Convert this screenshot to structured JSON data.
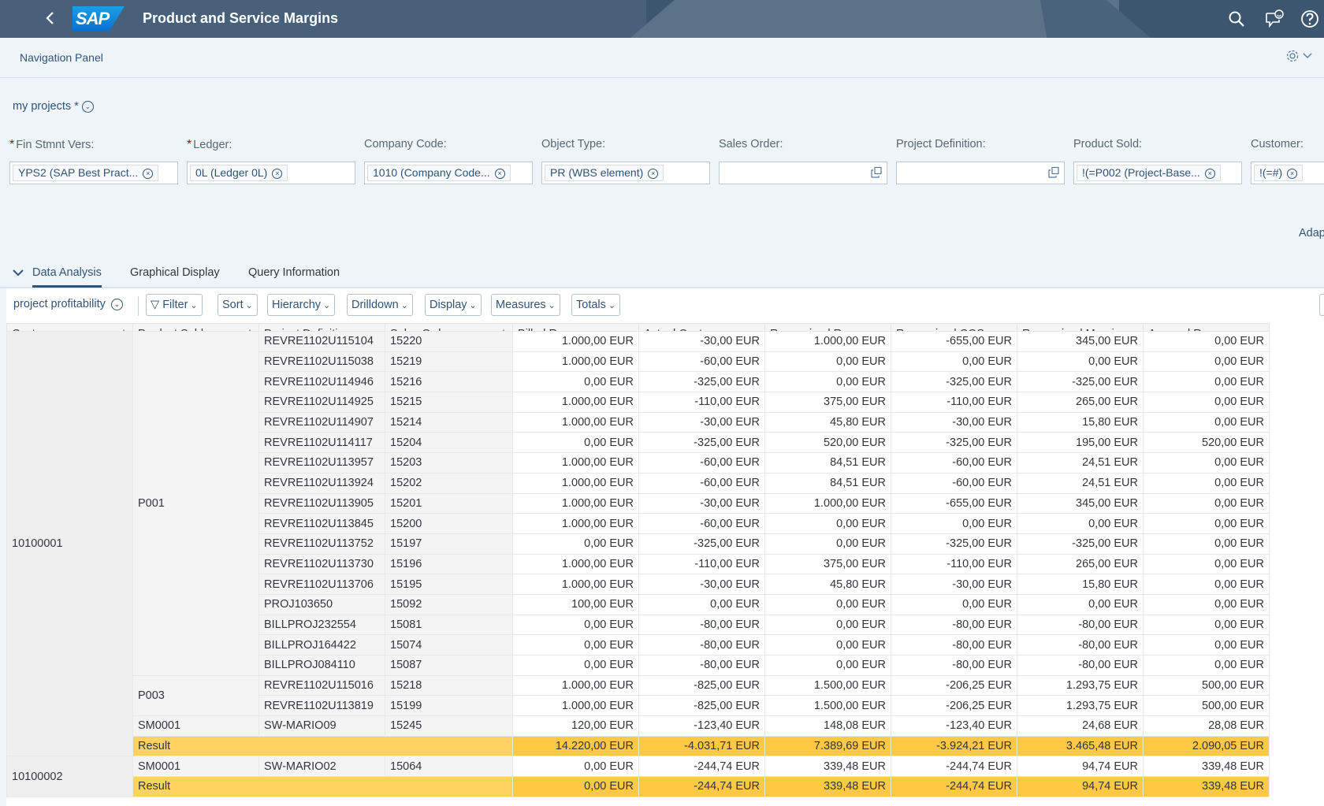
{
  "shell": {
    "app_title": "Product and Service Margins",
    "logo_text": "SAP",
    "icons": [
      "search-icon",
      "feedback-icon",
      "help-icon"
    ]
  },
  "nav_panel": {
    "label": "Navigation Panel"
  },
  "variant": {
    "label": "my projects *"
  },
  "filters": [
    {
      "label": "Fin Stmnt Vers:",
      "required": true,
      "token": "YPS2 (SAP Best Pract...",
      "value_help": false
    },
    {
      "label": "Ledger:",
      "required": true,
      "token": "0L (Ledger 0L)",
      "value_help": false
    },
    {
      "label": "Company Code:",
      "required": false,
      "token": "1010 (Company Code...",
      "value_help": false
    },
    {
      "label": "Object Type:",
      "required": false,
      "token": "PR (WBS element)",
      "value_help": false
    },
    {
      "label": "Sales Order:",
      "required": false,
      "token": "",
      "value_help": true
    },
    {
      "label": "Project Definition:",
      "required": false,
      "token": "",
      "value_help": true
    },
    {
      "label": "Product Sold:",
      "required": false,
      "token": "!(=P002 (Project-Base...",
      "value_help": false
    },
    {
      "label": "Customer:",
      "required": false,
      "token": "!(=#)",
      "value_help": false
    }
  ],
  "adapt_label": "Adap",
  "tabs": [
    {
      "label": "Data Analysis",
      "selected": true
    },
    {
      "label": "Graphical Display",
      "selected": false
    },
    {
      "label": "Query Information",
      "selected": false
    }
  ],
  "toolbar": {
    "view_label": "project profitability",
    "buttons": [
      "Filter",
      "Sort",
      "Hierarchy",
      "Drilldown",
      "Display",
      "Measures",
      "Totals"
    ]
  },
  "table": {
    "columns": [
      "Customer",
      "Product Sold",
      "Project Definition",
      "Sales Order",
      "Billed Revenue",
      "Actual Cost",
      "Recognized Revenue",
      "Recognized COS",
      "Recognized Margin",
      "Accrued Revenue"
    ],
    "groups": [
      {
        "customer": "10100001",
        "products": [
          {
            "product": "P001",
            "rows": [
              [
                "REVRE1102U115104",
                "15220",
                "1.000,00 EUR",
                "-30,00 EUR",
                "1.000,00 EUR",
                "-655,00 EUR",
                "345,00 EUR",
                "0,00 EUR"
              ],
              [
                "REVRE1102U115038",
                "15219",
                "1.000,00 EUR",
                "-60,00 EUR",
                "0,00 EUR",
                "0,00 EUR",
                "0,00 EUR",
                "0,00 EUR"
              ],
              [
                "REVRE1102U114946",
                "15216",
                "0,00 EUR",
                "-325,00 EUR",
                "0,00 EUR",
                "-325,00 EUR",
                "-325,00 EUR",
                "0,00 EUR"
              ],
              [
                "REVRE1102U114925",
                "15215",
                "1.000,00 EUR",
                "-110,00 EUR",
                "375,00 EUR",
                "-110,00 EUR",
                "265,00 EUR",
                "0,00 EUR"
              ],
              [
                "REVRE1102U114907",
                "15214",
                "1.000,00 EUR",
                "-30,00 EUR",
                "45,80 EUR",
                "-30,00 EUR",
                "15,80 EUR",
                "0,00 EUR"
              ],
              [
                "REVRE1102U114117",
                "15204",
                "0,00 EUR",
                "-325,00 EUR",
                "520,00 EUR",
                "-325,00 EUR",
                "195,00 EUR",
                "520,00 EUR"
              ],
              [
                "REVRE1102U113957",
                "15203",
                "1.000,00 EUR",
                "-60,00 EUR",
                "84,51 EUR",
                "-60,00 EUR",
                "24,51 EUR",
                "0,00 EUR"
              ],
              [
                "REVRE1102U113924",
                "15202",
                "1.000,00 EUR",
                "-60,00 EUR",
                "84,51 EUR",
                "-60,00 EUR",
                "24,51 EUR",
                "0,00 EUR"
              ],
              [
                "REVRE1102U113905",
                "15201",
                "1.000,00 EUR",
                "-30,00 EUR",
                "1.000,00 EUR",
                "-655,00 EUR",
                "345,00 EUR",
                "0,00 EUR"
              ],
              [
                "REVRE1102U113845",
                "15200",
                "1.000,00 EUR",
                "-60,00 EUR",
                "0,00 EUR",
                "0,00 EUR",
                "0,00 EUR",
                "0,00 EUR"
              ],
              [
                "REVRE1102U113752",
                "15197",
                "0,00 EUR",
                "-325,00 EUR",
                "0,00 EUR",
                "-325,00 EUR",
                "-325,00 EUR",
                "0,00 EUR"
              ],
              [
                "REVRE1102U113730",
                "15196",
                "1.000,00 EUR",
                "-110,00 EUR",
                "375,00 EUR",
                "-110,00 EUR",
                "265,00 EUR",
                "0,00 EUR"
              ],
              [
                "REVRE1102U113706",
                "15195",
                "1.000,00 EUR",
                "-30,00 EUR",
                "45,80 EUR",
                "-30,00 EUR",
                "15,80 EUR",
                "0,00 EUR"
              ],
              [
                "PROJ103650",
                "15092",
                "100,00 EUR",
                "0,00 EUR",
                "0,00 EUR",
                "0,00 EUR",
                "0,00 EUR",
                "0,00 EUR"
              ],
              [
                "BILLPROJ232554",
                "15081",
                "0,00 EUR",
                "-80,00 EUR",
                "0,00 EUR",
                "-80,00 EUR",
                "-80,00 EUR",
                "0,00 EUR"
              ],
              [
                "BILLPROJ164422",
                "15074",
                "0,00 EUR",
                "-80,00 EUR",
                "0,00 EUR",
                "-80,00 EUR",
                "-80,00 EUR",
                "0,00 EUR"
              ],
              [
                "BILLPROJ084110",
                "15087",
                "0,00 EUR",
                "-80,00 EUR",
                "0,00 EUR",
                "-80,00 EUR",
                "-80,00 EUR",
                "0,00 EUR"
              ]
            ]
          },
          {
            "product": "P003",
            "rows": [
              [
                "REVRE1102U115016",
                "15218",
                "1.000,00 EUR",
                "-825,00 EUR",
                "1.500,00 EUR",
                "-206,25 EUR",
                "1.293,75 EUR",
                "500,00 EUR"
              ],
              [
                "REVRE1102U113819",
                "15199",
                "1.000,00 EUR",
                "-825,00 EUR",
                "1.500,00 EUR",
                "-206,25 EUR",
                "1.293,75 EUR",
                "500,00 EUR"
              ]
            ]
          },
          {
            "product": "SM0001",
            "rows": [
              [
                "SW-MARIO09",
                "15245",
                "120,00 EUR",
                "-123,40 EUR",
                "148,08 EUR",
                "-123,40 EUR",
                "24,68 EUR",
                "28,08 EUR"
              ]
            ]
          }
        ],
        "result": {
          "label": "Result",
          "values": [
            "14.220,00 EUR",
            "-4.031,71 EUR",
            "7.389,69 EUR",
            "-3.924,21 EUR",
            "3.465,48 EUR",
            "2.090,05 EUR"
          ]
        }
      },
      {
        "customer": "10100002",
        "products": [
          {
            "product": "SM0001",
            "rows": [
              [
                "SW-MARIO02",
                "15064",
                "0,00 EUR",
                "-244,74 EUR",
                "339,48 EUR",
                "-244,74 EUR",
                "94,74 EUR",
                "339,48 EUR"
              ]
            ]
          }
        ],
        "result": {
          "label": "Result",
          "values": [
            "0,00 EUR",
            "-244,74 EUR",
            "339,48 EUR",
            "-244,74 EUR",
            "94,74 EUR",
            "339,48 EUR"
          ]
        }
      }
    ]
  }
}
